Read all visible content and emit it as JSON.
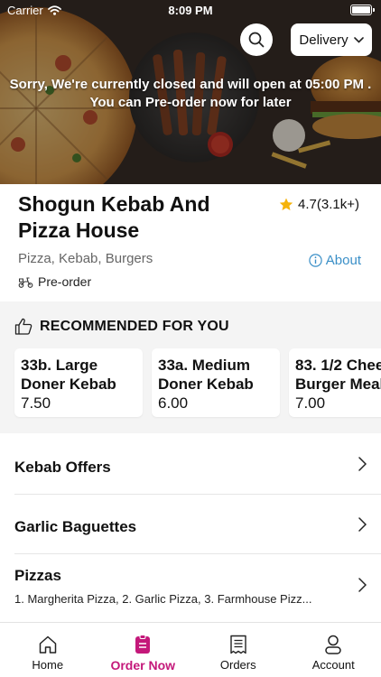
{
  "status_bar": {
    "carrier": "Carrier",
    "time": "8:09 PM"
  },
  "header": {
    "delivery_label": "Delivery",
    "closed_message_line1": "Sorry, We're currently closed and will open at 05:00 PM .",
    "closed_message_line2": "You can Pre-order now for later"
  },
  "restaurant": {
    "name_line1": "Shogun Kebab And",
    "name_line2": "Pizza House",
    "rating": "4.7(3.1k+)",
    "cuisines": "Pizza, Kebab, Burgers",
    "about_label": "About",
    "preorder_label": "Pre-order"
  },
  "recommended": {
    "title": "RECOMMENDED FOR YOU",
    "items": [
      {
        "line1": "33b. Large",
        "line2": "Doner Kebab",
        "price": "7.50"
      },
      {
        "line1": "33a. Medium",
        "line2": "Doner Kebab",
        "price": "6.00"
      },
      {
        "line1": "83. 1/2 Chee",
        "line2": "Burger Meal",
        "price": "7.00"
      }
    ]
  },
  "categories": [
    {
      "title": "Kebab Offers",
      "subtitle": ""
    },
    {
      "title": "Garlic Baguettes",
      "subtitle": ""
    },
    {
      "title": "Pizzas",
      "subtitle": "1. Margherita Pizza, 2. Garlic Pizza, 3. Farmhouse Pizz..."
    }
  ],
  "tabs": [
    {
      "label": "Home",
      "icon": "home-icon",
      "active": false
    },
    {
      "label": "Order Now",
      "icon": "order-icon",
      "active": true
    },
    {
      "label": "Orders",
      "icon": "receipt-icon",
      "active": false
    },
    {
      "label": "Account",
      "icon": "person-icon",
      "active": false
    }
  ],
  "colors": {
    "accent": "#c4187a",
    "link": "#3a8fc7",
    "star": "#f5b30a",
    "section_bg": "#f4f4f4"
  }
}
